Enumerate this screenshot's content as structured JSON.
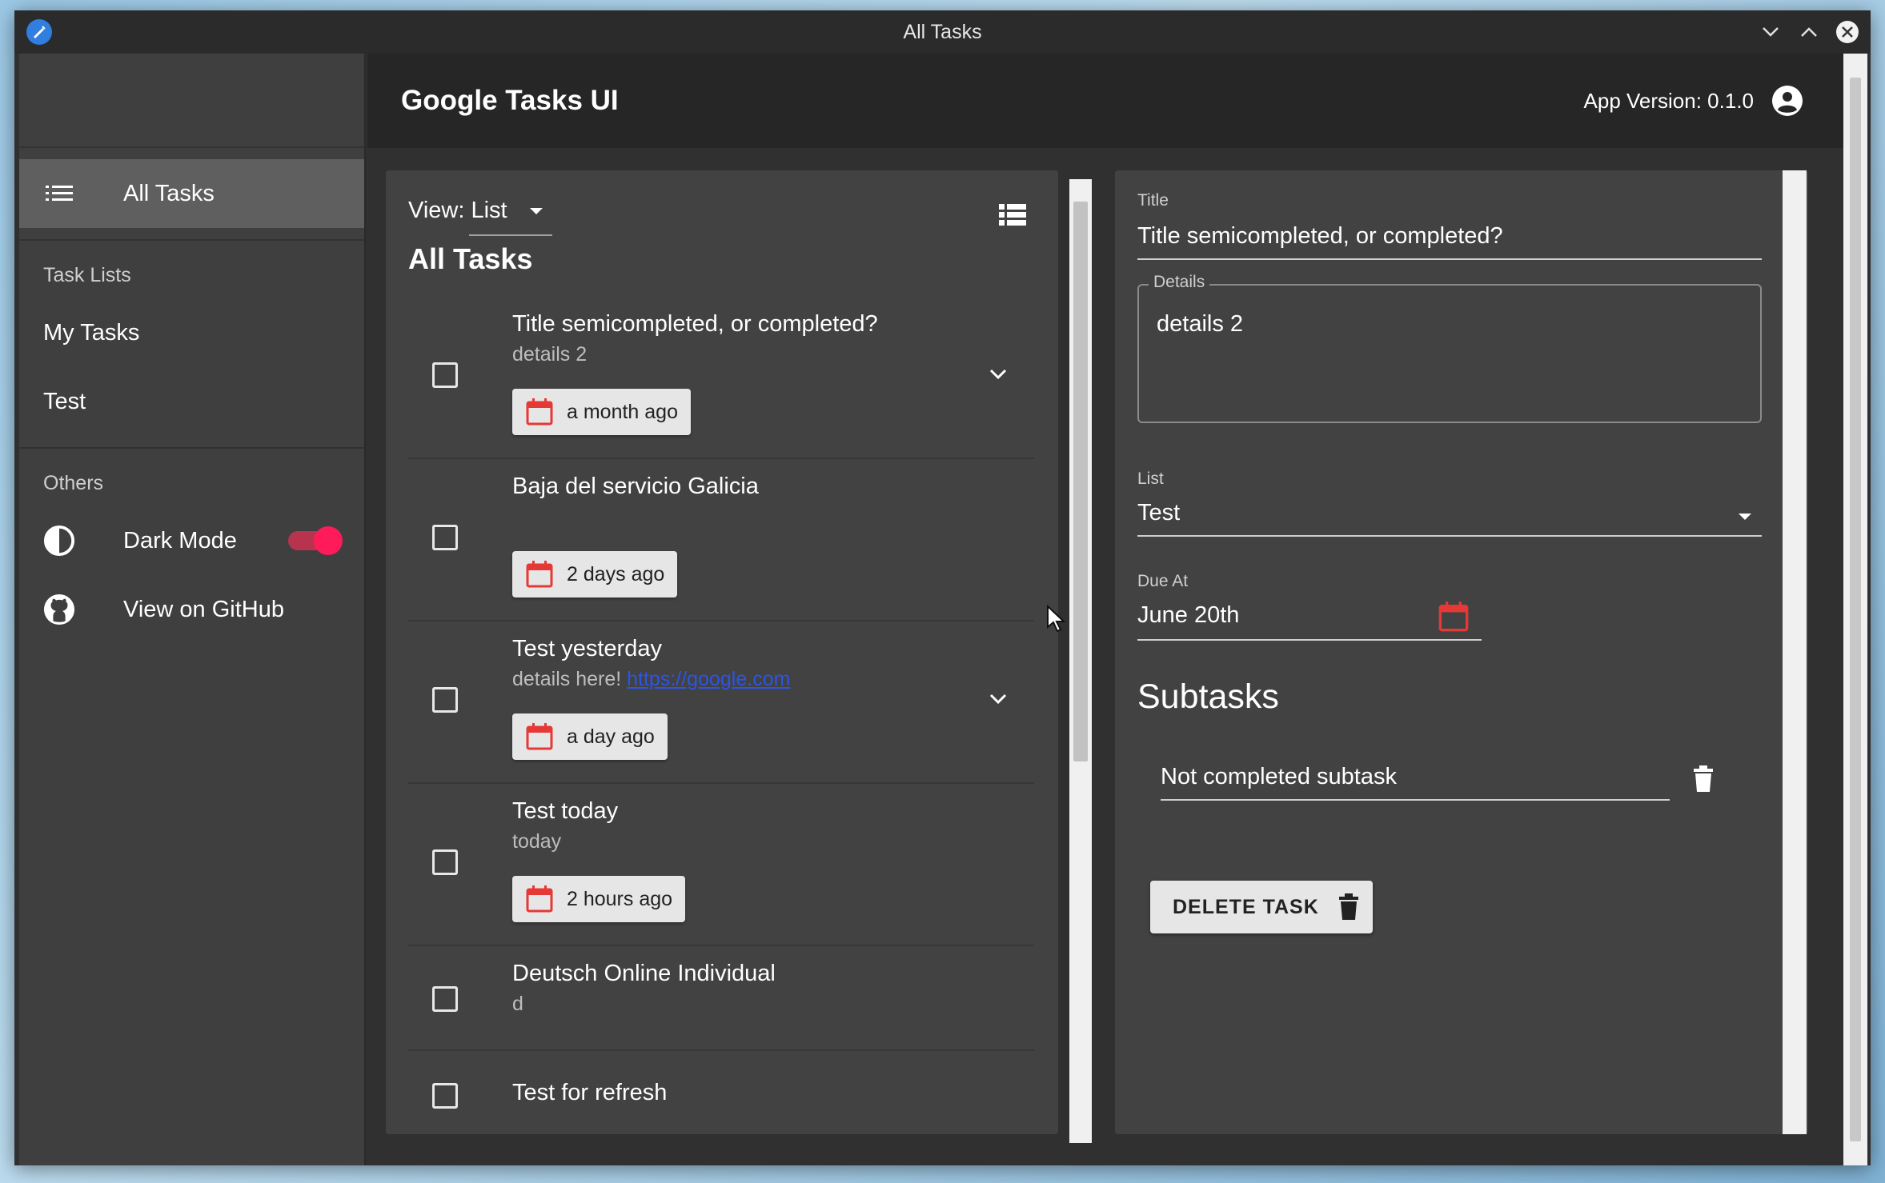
{
  "window": {
    "title": "All Tasks"
  },
  "appbar": {
    "title": "Google Tasks UI",
    "version": "App Version: 0.1.0"
  },
  "drawer": {
    "all_tasks": "All Tasks",
    "task_lists_header": "Task Lists",
    "task_lists": [
      "My Tasks",
      "Test"
    ],
    "others_header": "Others",
    "dark_mode": "Dark Mode",
    "dark_mode_on": true,
    "github": "View on GitHub"
  },
  "list_panel": {
    "view_select": "View: List",
    "title": "All Tasks",
    "tasks": [
      {
        "title": "Title semicompleted, or completed?",
        "details": "details 2",
        "due": "a month ago"
      },
      {
        "title": "Baja del servicio Galicia",
        "details": "",
        "due": "2 days ago"
      },
      {
        "title": "Test yesterday",
        "details_prefix": "details here! ",
        "details_link": "https://google.com",
        "due": "a day ago"
      },
      {
        "title": "Test today",
        "details": "today",
        "due": "2 hours ago"
      },
      {
        "title": "Deutsch Online Individual",
        "details": "d"
      },
      {
        "title": "Test for refresh",
        "details": ""
      }
    ]
  },
  "detail_panel": {
    "title_label": "Title",
    "title_value": "Title semicompleted, or completed?",
    "details_label": "Details",
    "details_value": "details 2",
    "list_label": "List",
    "list_value": "Test",
    "due_label": "Due At",
    "due_value": "June 20th",
    "subtasks_header": "Subtasks",
    "subtasks": [
      "Not completed subtask"
    ],
    "delete_label": "DELETE TASK"
  },
  "colors": {
    "accent_red": "#e53935",
    "toggle_pink": "#ff1b59",
    "link_blue": "#2b55e6"
  }
}
